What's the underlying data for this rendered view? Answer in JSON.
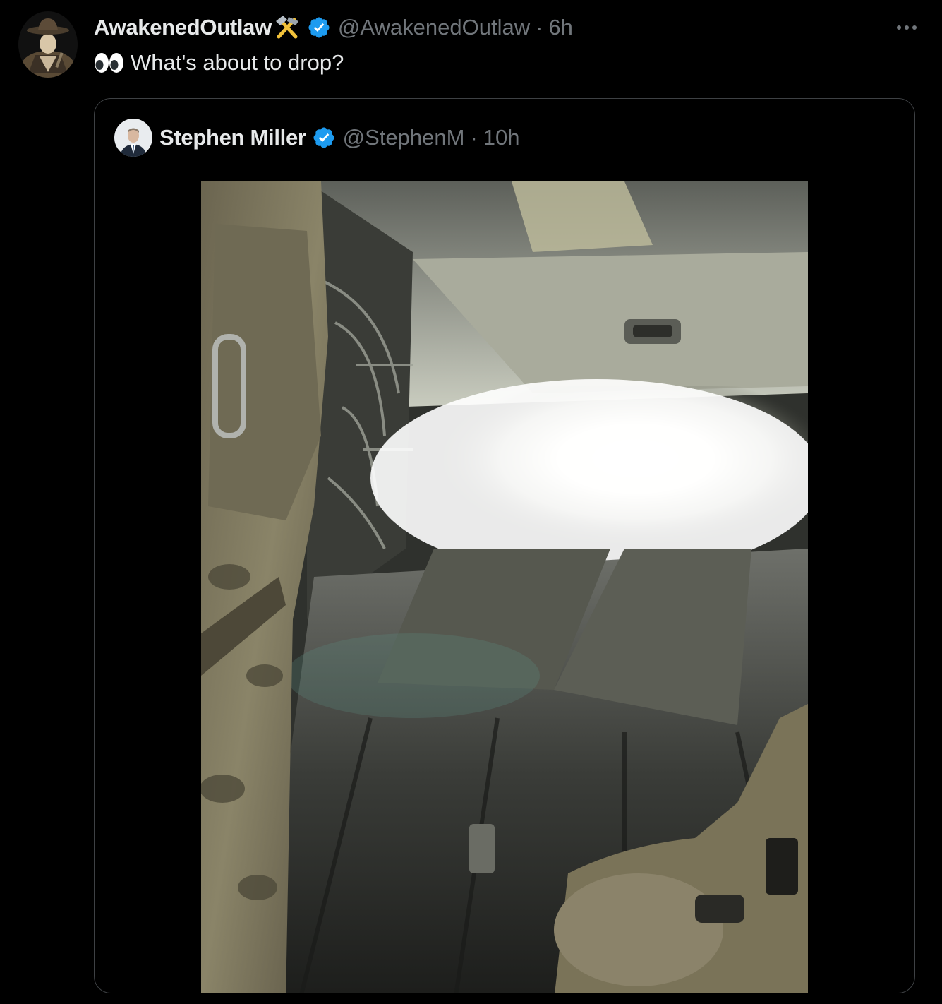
{
  "tweet": {
    "author": {
      "display_name": "AwakenedOutlaw",
      "name_emoji": "hammer-and-pick",
      "verified": true,
      "handle": "@AwakenedOutlaw",
      "separator": "·",
      "time": "6h",
      "avatar": "cowboy-portrait"
    },
    "text_emoji": "eyes",
    "text": "What's about to drop?",
    "more_button": "more-options-icon"
  },
  "quoted_tweet": {
    "author": {
      "display_name": "Stephen Miller",
      "verified": true,
      "handle": "@StephenM",
      "separator": "·",
      "time": "10h",
      "avatar": "man-in-suit-portrait"
    },
    "media": {
      "type": "photo",
      "subject": "aircraft cargo bay with open ramp"
    }
  },
  "colors": {
    "background": "#000000",
    "primary_text": "#e7e9ea",
    "secondary_text": "#71767b",
    "verified_blue": "#1d9bf0",
    "card_border": "#3e4144"
  }
}
